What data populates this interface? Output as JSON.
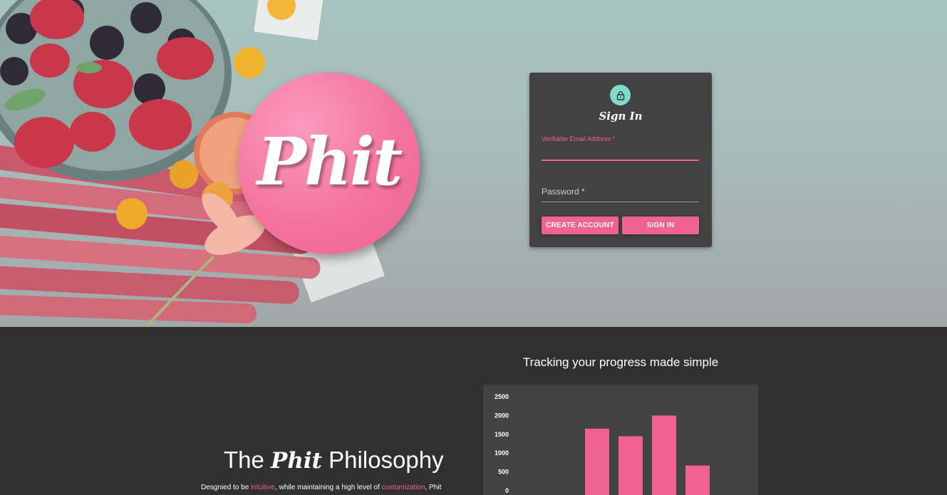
{
  "hero": {
    "logo_text": "Phit"
  },
  "signin": {
    "title": "Sign In",
    "email_label": "Verifiable Email Address *",
    "password_label": "Password *",
    "create_account_label": "CREATE ACCOUNT",
    "sign_in_label": "SIGN IN",
    "lock_icon": "lock-icon"
  },
  "philosophy": {
    "title_prefix": "The",
    "title_brand": "Phit",
    "title_suffix": "Philosophy",
    "text_1": "Desgnied to be ",
    "text_hl_1": "intuitive",
    "text_2": ", while maintaining a high level of ",
    "text_hl_2": "customization",
    "text_3": ", Phit"
  },
  "progress": {
    "heading": "Tracking your progress made simple"
  },
  "colors": {
    "accent": "#f06292",
    "teal": "#7fdccd",
    "card": "#424242",
    "page_dark": "#303030"
  },
  "chart_data": {
    "type": "bar",
    "title": "",
    "xlabel": "",
    "ylabel": "",
    "ylim": [
      0,
      2500
    ],
    "yticks": [
      "2500",
      "2000",
      "1500",
      "1000",
      "500",
      "0"
    ],
    "categories": [
      "",
      "",
      "",
      ""
    ],
    "values": [
      1650,
      1450,
      2000,
      670
    ],
    "color": "#f06292"
  }
}
